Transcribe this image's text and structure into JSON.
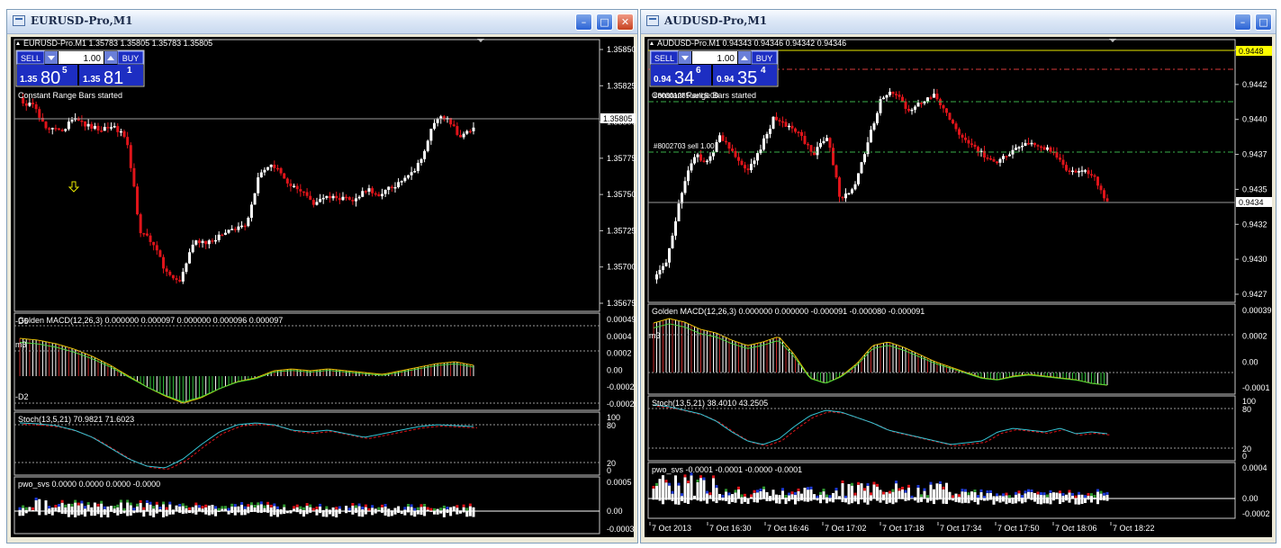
{
  "windows": [
    {
      "id": "eurusd",
      "title": "EURUSD-Pro,M1",
      "chart_header": "EURUSD-Pro.M1  1.35783 1.35805 1.35783 1.35805",
      "trade_panel": {
        "sell_label": "SELL",
        "buy_label": "BUY",
        "lot_value": "1.00",
        "sell_price_prefix": "1.35",
        "sell_price_big": "80",
        "sell_price_sup": "5",
        "buy_price_prefix": "1.35",
        "buy_price_big": "81",
        "buy_price_sup": "1"
      },
      "status_text": "Constant Range Bars started",
      "price_axis": [
        "1.35850",
        "1.35825",
        "1.35800",
        "1.35775",
        "1.35750",
        "1.35725",
        "1.35700",
        "1.35675"
      ],
      "current_price": "1.35805",
      "macd": {
        "label": "Golden MACD(12,26,3) 0.000000 0.000097 0.000000 0.000096 0.000097",
        "axis": [
          "0.00049",
          "0.0004",
          "0.0002",
          "0.00",
          "-0.0002",
          "-0.00026"
        ],
        "level_labels": [
          "m3",
          "-D2",
          "-D5"
        ]
      },
      "stoch": {
        "label": "Stoch(13,5,21) 70.9821 71.6023",
        "axis": [
          "100",
          "80",
          "20",
          "0"
        ]
      },
      "pwo": {
        "label": "pwo_svs 0.0000 0.0000 0.0000 -0.0000",
        "axis": [
          "0.0005",
          "0.00",
          "-0.0003"
        ]
      },
      "time_axis": []
    },
    {
      "id": "audusd",
      "title": "AUDUSD-Pro,M1",
      "chart_header": "AUDUSD-Pro.M1  0.94343 0.94346 0.94342 0.94346",
      "trade_panel": {
        "sell_label": "SELL",
        "buy_label": "BUY",
        "lot_value": "1.00",
        "sell_price_prefix": "0.94",
        "sell_price_big": "34",
        "sell_price_sup": "6",
        "buy_price_prefix": "0.94",
        "buy_price_big": "35",
        "buy_price_sup": "4"
      },
      "status_text": "Constant Range Bars started",
      "order_labels": [
        "#80001285 sell 5.00",
        "#8002703 sell 1.00"
      ],
      "price_axis": [
        "0.9445",
        "0.9442",
        "0.9440",
        "0.9437",
        "0.9435",
        "0.9432",
        "0.9430",
        "0.9427"
      ],
      "current_price": "0.9434",
      "top_price": "0.9448",
      "macd": {
        "label": "Golden MACD(12,26,3) 0.000000 0.000000 -0.000091 -0.000080 -0.000091",
        "axis": [
          "0.00039",
          "0.0002",
          "0.00",
          "-0.0001"
        ],
        "level_labels": [
          "m3"
        ]
      },
      "stoch": {
        "label": "Stoch(13,5,21) 38.4010 43.2505",
        "axis": [
          "100",
          "80",
          "20",
          "0"
        ]
      },
      "pwo": {
        "label": "pwo_svs -0.0001 -0.0001 -0.0000 -0.0001",
        "axis": [
          "0.0004",
          "0.00",
          "-0.0002"
        ]
      },
      "time_axis": [
        "7 Oct 2013",
        "7 Oct 16:30",
        "7 Oct 16:46",
        "7 Oct 17:02",
        "7 Oct 17:18",
        "7 Oct 17:34",
        "7 Oct 17:50",
        "7 Oct 18:06",
        "7 Oct 18:22"
      ]
    }
  ],
  "window_buttons": {
    "minimize": "–",
    "maximize": "□",
    "close": "✕"
  },
  "colors": {
    "bull": "#ffffff",
    "bear": "#e0141a",
    "macd_line": "#e8c200",
    "signal_line": "#4ad23a",
    "stoch_main": "#33c6d6",
    "stoch_signal": "#e0141a",
    "panel_blue": "#1d2ec2"
  }
}
